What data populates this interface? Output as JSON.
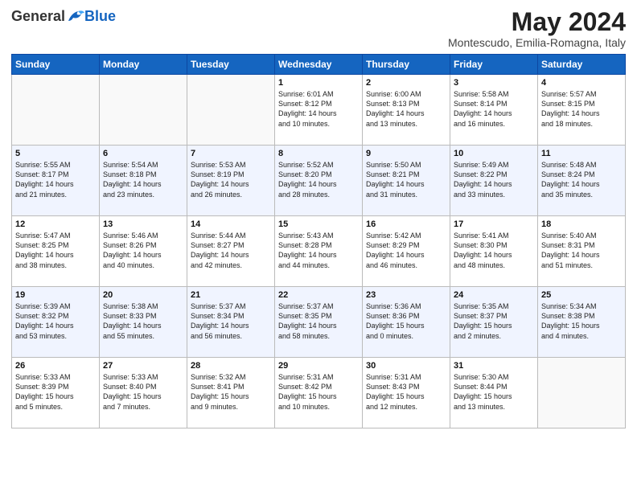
{
  "header": {
    "logo_general": "General",
    "logo_blue": "Blue",
    "month_title": "May 2024",
    "subtitle": "Montescudo, Emilia-Romagna, Italy"
  },
  "days_of_week": [
    "Sunday",
    "Monday",
    "Tuesday",
    "Wednesday",
    "Thursday",
    "Friday",
    "Saturday"
  ],
  "weeks": [
    [
      {
        "num": "",
        "info": ""
      },
      {
        "num": "",
        "info": ""
      },
      {
        "num": "",
        "info": ""
      },
      {
        "num": "1",
        "info": "Sunrise: 6:01 AM\nSunset: 8:12 PM\nDaylight: 14 hours\nand 10 minutes."
      },
      {
        "num": "2",
        "info": "Sunrise: 6:00 AM\nSunset: 8:13 PM\nDaylight: 14 hours\nand 13 minutes."
      },
      {
        "num": "3",
        "info": "Sunrise: 5:58 AM\nSunset: 8:14 PM\nDaylight: 14 hours\nand 16 minutes."
      },
      {
        "num": "4",
        "info": "Sunrise: 5:57 AM\nSunset: 8:15 PM\nDaylight: 14 hours\nand 18 minutes."
      }
    ],
    [
      {
        "num": "5",
        "info": "Sunrise: 5:55 AM\nSunset: 8:17 PM\nDaylight: 14 hours\nand 21 minutes."
      },
      {
        "num": "6",
        "info": "Sunrise: 5:54 AM\nSunset: 8:18 PM\nDaylight: 14 hours\nand 23 minutes."
      },
      {
        "num": "7",
        "info": "Sunrise: 5:53 AM\nSunset: 8:19 PM\nDaylight: 14 hours\nand 26 minutes."
      },
      {
        "num": "8",
        "info": "Sunrise: 5:52 AM\nSunset: 8:20 PM\nDaylight: 14 hours\nand 28 minutes."
      },
      {
        "num": "9",
        "info": "Sunrise: 5:50 AM\nSunset: 8:21 PM\nDaylight: 14 hours\nand 31 minutes."
      },
      {
        "num": "10",
        "info": "Sunrise: 5:49 AM\nSunset: 8:22 PM\nDaylight: 14 hours\nand 33 minutes."
      },
      {
        "num": "11",
        "info": "Sunrise: 5:48 AM\nSunset: 8:24 PM\nDaylight: 14 hours\nand 35 minutes."
      }
    ],
    [
      {
        "num": "12",
        "info": "Sunrise: 5:47 AM\nSunset: 8:25 PM\nDaylight: 14 hours\nand 38 minutes."
      },
      {
        "num": "13",
        "info": "Sunrise: 5:46 AM\nSunset: 8:26 PM\nDaylight: 14 hours\nand 40 minutes."
      },
      {
        "num": "14",
        "info": "Sunrise: 5:44 AM\nSunset: 8:27 PM\nDaylight: 14 hours\nand 42 minutes."
      },
      {
        "num": "15",
        "info": "Sunrise: 5:43 AM\nSunset: 8:28 PM\nDaylight: 14 hours\nand 44 minutes."
      },
      {
        "num": "16",
        "info": "Sunrise: 5:42 AM\nSunset: 8:29 PM\nDaylight: 14 hours\nand 46 minutes."
      },
      {
        "num": "17",
        "info": "Sunrise: 5:41 AM\nSunset: 8:30 PM\nDaylight: 14 hours\nand 48 minutes."
      },
      {
        "num": "18",
        "info": "Sunrise: 5:40 AM\nSunset: 8:31 PM\nDaylight: 14 hours\nand 51 minutes."
      }
    ],
    [
      {
        "num": "19",
        "info": "Sunrise: 5:39 AM\nSunset: 8:32 PM\nDaylight: 14 hours\nand 53 minutes."
      },
      {
        "num": "20",
        "info": "Sunrise: 5:38 AM\nSunset: 8:33 PM\nDaylight: 14 hours\nand 55 minutes."
      },
      {
        "num": "21",
        "info": "Sunrise: 5:37 AM\nSunset: 8:34 PM\nDaylight: 14 hours\nand 56 minutes."
      },
      {
        "num": "22",
        "info": "Sunrise: 5:37 AM\nSunset: 8:35 PM\nDaylight: 14 hours\nand 58 minutes."
      },
      {
        "num": "23",
        "info": "Sunrise: 5:36 AM\nSunset: 8:36 PM\nDaylight: 15 hours\nand 0 minutes."
      },
      {
        "num": "24",
        "info": "Sunrise: 5:35 AM\nSunset: 8:37 PM\nDaylight: 15 hours\nand 2 minutes."
      },
      {
        "num": "25",
        "info": "Sunrise: 5:34 AM\nSunset: 8:38 PM\nDaylight: 15 hours\nand 4 minutes."
      }
    ],
    [
      {
        "num": "26",
        "info": "Sunrise: 5:33 AM\nSunset: 8:39 PM\nDaylight: 15 hours\nand 5 minutes."
      },
      {
        "num": "27",
        "info": "Sunrise: 5:33 AM\nSunset: 8:40 PM\nDaylight: 15 hours\nand 7 minutes."
      },
      {
        "num": "28",
        "info": "Sunrise: 5:32 AM\nSunset: 8:41 PM\nDaylight: 15 hours\nand 9 minutes."
      },
      {
        "num": "29",
        "info": "Sunrise: 5:31 AM\nSunset: 8:42 PM\nDaylight: 15 hours\nand 10 minutes."
      },
      {
        "num": "30",
        "info": "Sunrise: 5:31 AM\nSunset: 8:43 PM\nDaylight: 15 hours\nand 12 minutes."
      },
      {
        "num": "31",
        "info": "Sunrise: 5:30 AM\nSunset: 8:44 PM\nDaylight: 15 hours\nand 13 minutes."
      },
      {
        "num": "",
        "info": ""
      }
    ]
  ]
}
